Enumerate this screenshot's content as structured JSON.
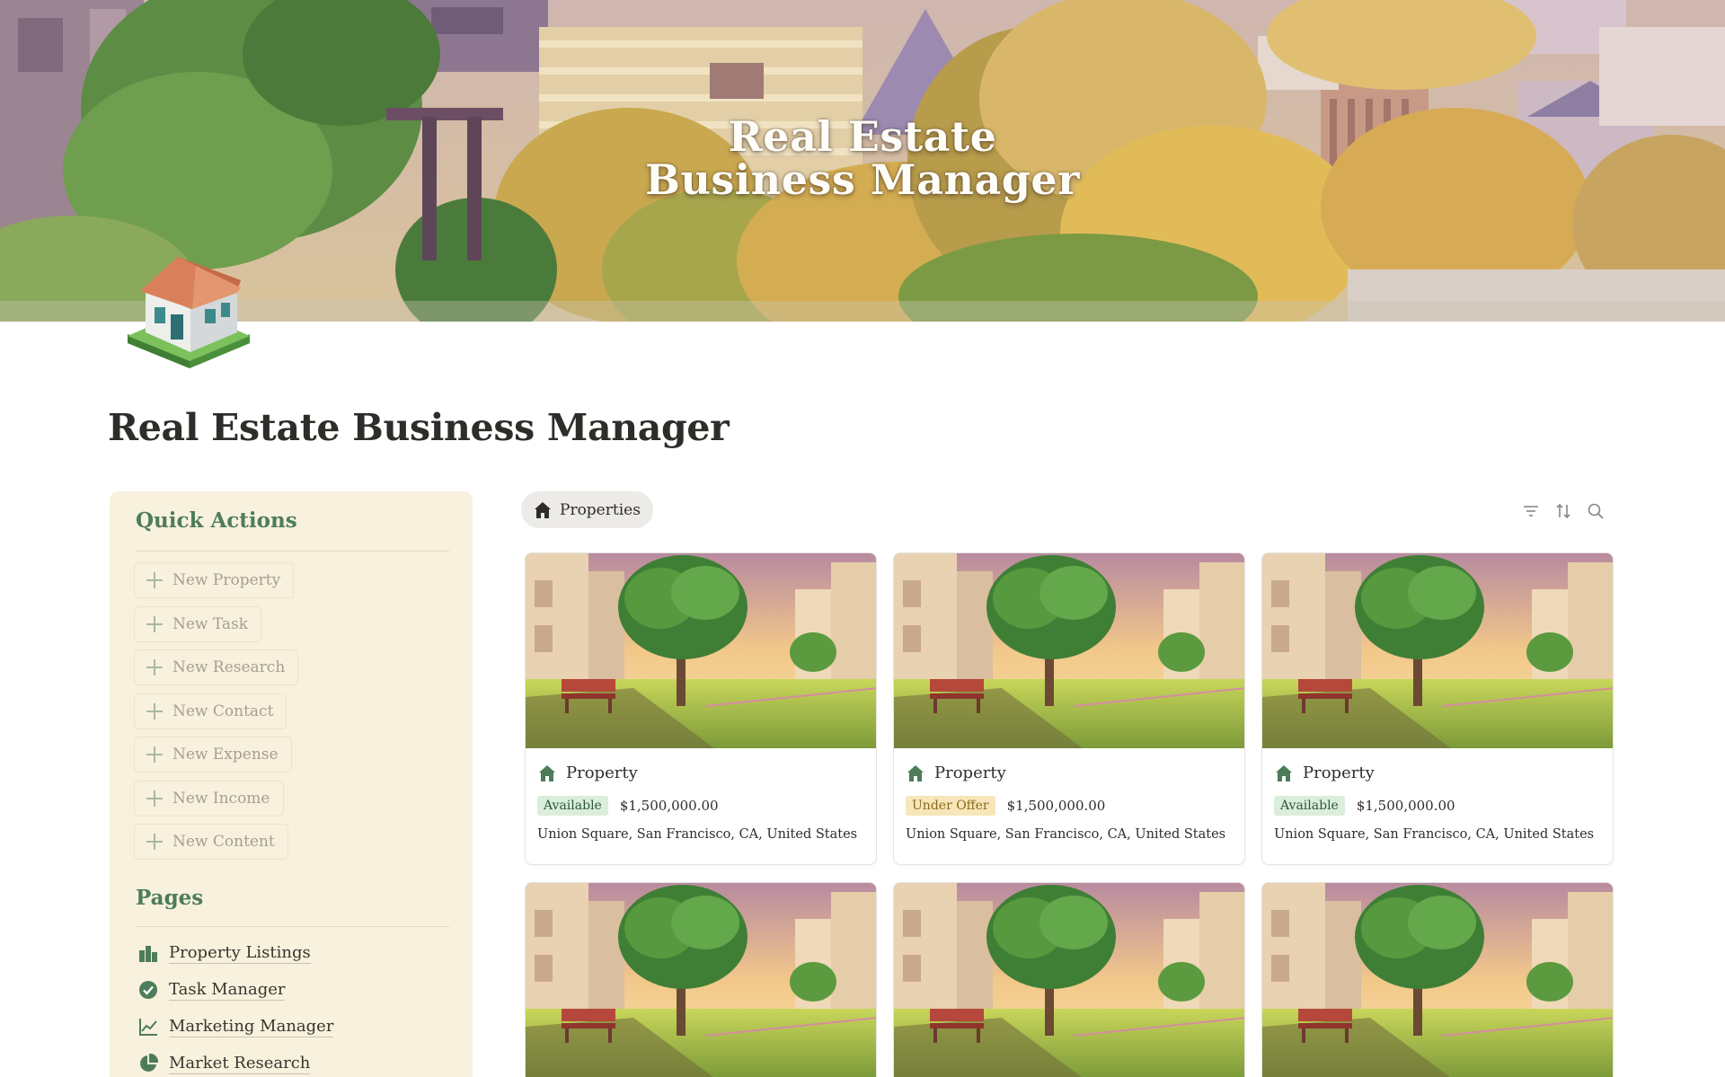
{
  "cover": {
    "title_line1": "Real Estate",
    "title_line2": "Business Manager"
  },
  "page": {
    "title": "Real Estate Business Manager"
  },
  "sidebar": {
    "quick_actions_heading": "Quick Actions",
    "quick_actions": [
      {
        "label": "New Property",
        "icon": "plus-icon"
      },
      {
        "label": "New Task",
        "icon": "plus-icon"
      },
      {
        "label": "New Research",
        "icon": "plus-icon"
      },
      {
        "label": "New Contact",
        "icon": "plus-icon"
      },
      {
        "label": "New Expense",
        "icon": "plus-icon"
      },
      {
        "label": "New Income",
        "icon": "plus-icon"
      },
      {
        "label": "New Content",
        "icon": "plus-icon"
      }
    ],
    "pages_heading": "Pages",
    "pages": [
      {
        "label": "Property Listings",
        "icon": "buildings-icon"
      },
      {
        "label": "Task Manager",
        "icon": "check-circle-icon"
      },
      {
        "label": "Marketing Manager",
        "icon": "line-chart-icon"
      },
      {
        "label": "Market Research",
        "icon": "pie-chart-icon"
      }
    ]
  },
  "gallery": {
    "view_tab": {
      "label": "Properties",
      "icon": "house-icon"
    },
    "tools": [
      "filter-icon",
      "sort-icon",
      "search-icon"
    ],
    "cards": [
      {
        "title": "Property",
        "status": "Available",
        "price": "$1,500,000.00",
        "address": "Union Square, San Francisco, CA, United States"
      },
      {
        "title": "Property",
        "status": "Under Offer",
        "price": "$1,500,000.00",
        "address": "Union Square, San Francisco, CA, United States"
      },
      {
        "title": "Property",
        "status": "Available",
        "price": "$1,500,000.00",
        "address": "Union Square, San Francisco, CA, United States"
      },
      {
        "title": "",
        "status": "",
        "price": "",
        "address": ""
      },
      {
        "title": "",
        "status": "",
        "price": "",
        "address": ""
      },
      {
        "title": "",
        "status": "",
        "price": "",
        "address": ""
      }
    ]
  },
  "colors": {
    "accent_green": "#4d7d58",
    "panel_bg": "#f8f1dd",
    "status_available_bg": "#dbeddb",
    "status_available_fg": "#2b593f",
    "status_under_offer_bg": "#f6e6b9",
    "status_under_offer_fg": "#8a6a1c"
  }
}
